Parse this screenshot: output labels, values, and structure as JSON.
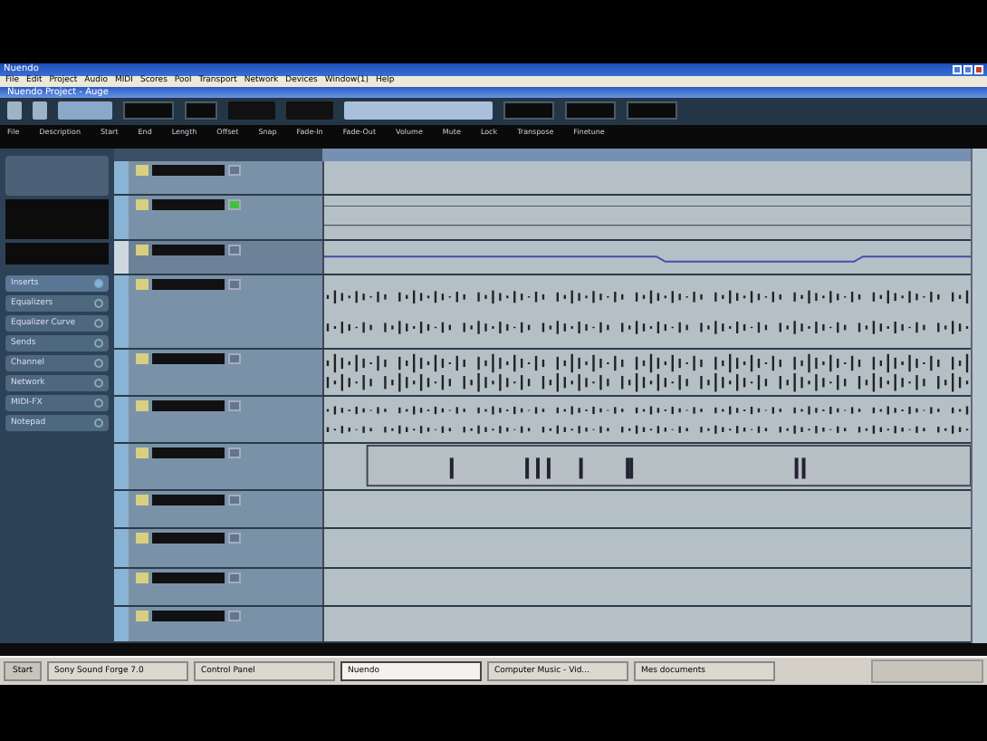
{
  "window": {
    "title": "Nuendo"
  },
  "menu": [
    "File",
    "Edit",
    "Project",
    "Audio",
    "MIDI",
    "Scores",
    "Pool",
    "Transport",
    "Network",
    "Devices",
    "Window(1)",
    "Help"
  ],
  "project": {
    "title": "Nuendo Project - Auge"
  },
  "info_line": [
    "File",
    "Description",
    "Start",
    "End",
    "Length",
    "Offset",
    "Snap",
    "Fade-In",
    "Fade-Out",
    "Volume",
    "Mute",
    "Lock",
    "Transpose",
    "Finetune"
  ],
  "inspector": {
    "sections": [
      {
        "label": "Inserts",
        "selected": true
      },
      {
        "label": "Equalizers",
        "selected": false
      },
      {
        "label": "Equalizer Curve",
        "selected": false
      },
      {
        "label": "Sends",
        "selected": false
      },
      {
        "label": "Channel",
        "selected": false
      },
      {
        "label": "Network",
        "selected": false
      },
      {
        "label": "MIDI-FX",
        "selected": false
      },
      {
        "label": "Notepad",
        "selected": false
      }
    ]
  },
  "tracks": [
    {
      "kind": "folder",
      "monitor": false
    },
    {
      "kind": "midi",
      "monitor": true
    },
    {
      "kind": "automation",
      "monitor": false
    },
    {
      "kind": "audio",
      "monitor": false
    },
    {
      "kind": "audio2",
      "monitor": false
    },
    {
      "kind": "audio3",
      "monitor": false
    },
    {
      "kind": "parts",
      "monitor": false
    },
    {
      "kind": "empty",
      "monitor": false
    },
    {
      "kind": "empty",
      "monitor": false
    },
    {
      "kind": "empty",
      "monitor": false
    },
    {
      "kind": "low",
      "monitor": false
    }
  ],
  "taskbar": {
    "start": "Start",
    "items": [
      {
        "label": "Sony Sound Forge 7.0",
        "selected": false
      },
      {
        "label": "Control Panel",
        "selected": false
      },
      {
        "label": "Nuendo",
        "selected": true
      },
      {
        "label": "Computer Music - Vid...",
        "selected": false
      },
      {
        "label": "Mes documents",
        "selected": false
      }
    ]
  }
}
